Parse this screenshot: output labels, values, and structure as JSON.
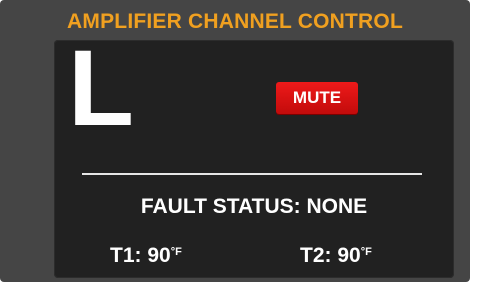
{
  "header": {
    "title": "AMPLIFIER CHANNEL CONTROL"
  },
  "channel": {
    "letter": "L",
    "mute_label": "MUTE",
    "mute_color": "#dd1111"
  },
  "fault": {
    "label": "FAULT STATUS:",
    "value": "NONE"
  },
  "temperatures": [
    {
      "label": "T1:",
      "value": "90",
      "unit": "°F"
    },
    {
      "label": "T2:",
      "value": "90",
      "unit": "°F"
    }
  ],
  "colors": {
    "title": "#f0a020",
    "frame": "#454545",
    "panel": "#212121",
    "text": "#ffffff"
  }
}
